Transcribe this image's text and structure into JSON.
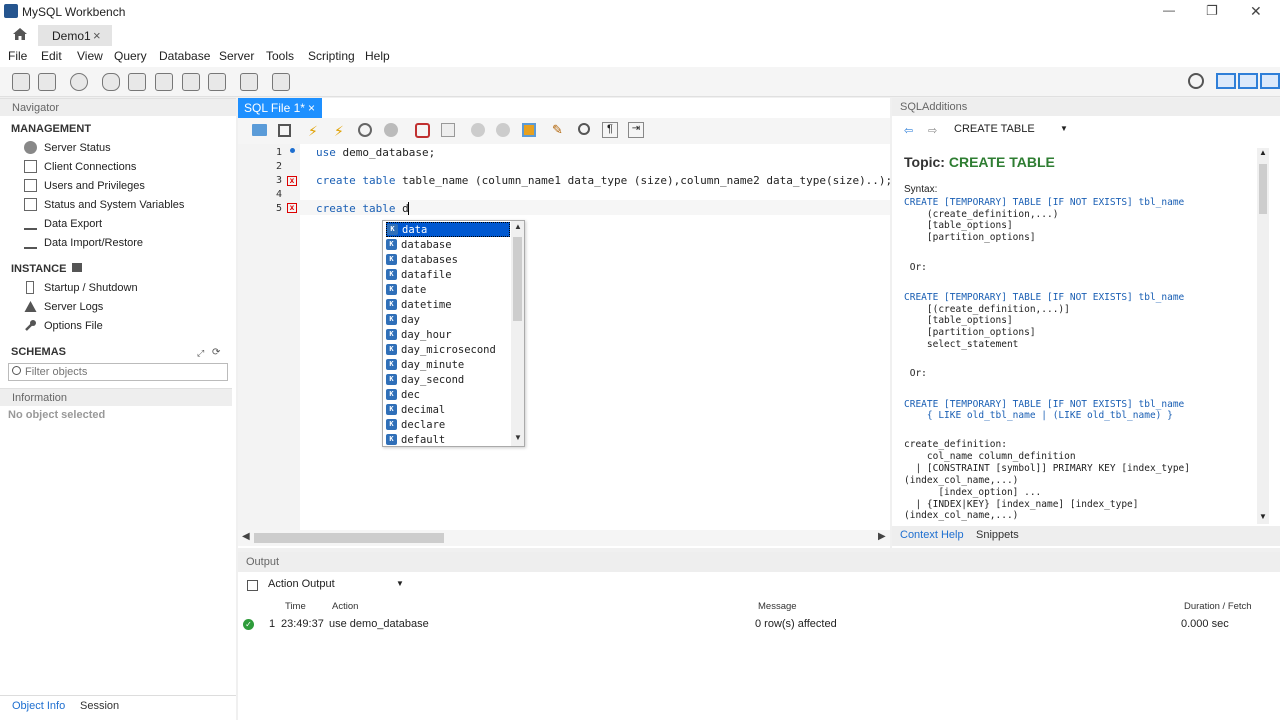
{
  "window": {
    "title": "MySQL Workbench",
    "min": "—",
    "max": "❐",
    "close": "✕"
  },
  "conn_tab": {
    "label": "Demo1",
    "close": "×"
  },
  "menu": [
    "File",
    "Edit",
    "View",
    "Query",
    "Database",
    "Server",
    "Tools",
    "Scripting",
    "Help"
  ],
  "navigator": {
    "title": "Navigator",
    "management": {
      "title": "MANAGEMENT",
      "items": [
        "Server Status",
        "Client Connections",
        "Users and Privileges",
        "Status and System Variables",
        "Data Export",
        "Data Import/Restore"
      ]
    },
    "instance": {
      "title": "INSTANCE",
      "items": [
        "Startup / Shutdown",
        "Server Logs",
        "Options File"
      ]
    },
    "schemas": {
      "title": "SCHEMAS",
      "filter_placeholder": "Filter objects"
    },
    "information": {
      "title": "Information",
      "text": "No object selected"
    },
    "bottom_tabs": [
      "Object Info",
      "Session"
    ]
  },
  "editor": {
    "tab_label": "SQL File 1*",
    "tab_close": "×",
    "line_numbers": [
      "1",
      "2",
      "3",
      "4",
      "5"
    ],
    "lines": [
      {
        "kw": "use",
        "rest": " demo_database;"
      },
      {
        "kw": "",
        "rest": ""
      },
      {
        "kw": "create table",
        "rest": " table_name (column_name1 data_type (size),column_name2 data_type(size)..);"
      },
      {
        "kw": "",
        "rest": ""
      },
      {
        "kw": "create table",
        "rest": " d"
      }
    ]
  },
  "autocomplete": {
    "items": [
      "data",
      "database",
      "databases",
      "datafile",
      "date",
      "datetime",
      "day",
      "day_hour",
      "day_microsecond",
      "day_minute",
      "day_second",
      "dec",
      "decimal",
      "declare",
      "default"
    ],
    "selected_index": 0,
    "badge": "K"
  },
  "sqladditions": {
    "title": "SQLAdditions",
    "dropdown_value": "CREATE TABLE",
    "topic_prefix": "Topic:",
    "topic": "CREATE TABLE",
    "syntax_label": "Syntax:",
    "help_lines": [
      "CREATE [TEMPORARY] TABLE [IF NOT EXISTS] tbl_name",
      "    (create_definition,...)",
      "    [table_options]",
      "    [partition_options]",
      "",
      " Or:",
      "",
      "CREATE [TEMPORARY] TABLE [IF NOT EXISTS] tbl_name",
      "    [(create_definition,...)]",
      "    [table_options]",
      "    [partition_options]",
      "    select_statement",
      "",
      " Or:",
      "",
      "CREATE [TEMPORARY] TABLE [IF NOT EXISTS] tbl_name",
      "    { LIKE old_tbl_name | (LIKE old_tbl_name) }",
      "",
      "create_definition:",
      "    col_name column_definition",
      "  | [CONSTRAINT [symbol]] PRIMARY KEY [index_type]",
      "(index_col_name,...)",
      "      [index_option] ...",
      "  | {INDEX|KEY} [index_name] [index_type]",
      "(index_col_name,...)",
      "      [index_option] ..."
    ],
    "bottom_tabs": [
      "Context Help",
      "Snippets"
    ]
  },
  "output": {
    "title": "Output",
    "dropdown_value": "Action Output",
    "columns": [
      "",
      "Time",
      "Action",
      "Message",
      "Duration / Fetch"
    ],
    "rows": [
      {
        "num": "1",
        "time": "23:49:37",
        "action": "use demo_database",
        "message": "0 row(s) affected",
        "duration": "0.000 sec"
      }
    ]
  }
}
